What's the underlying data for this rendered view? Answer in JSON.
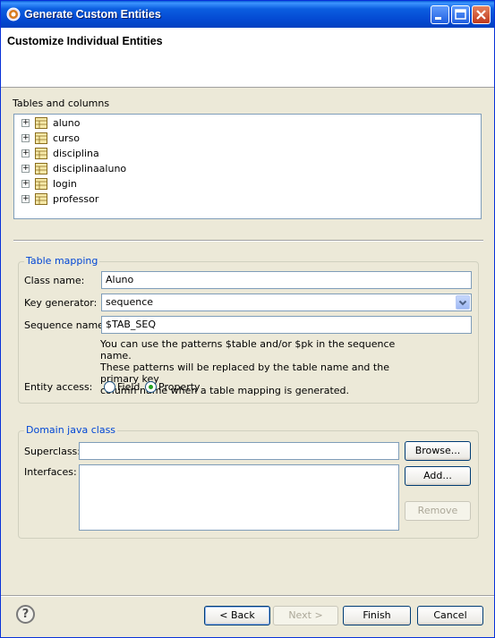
{
  "window": {
    "title": "Generate Custom Entities"
  },
  "header": {
    "title": "Customize Individual Entities"
  },
  "tables": {
    "label": "Tables and columns",
    "items": [
      "aluno",
      "curso",
      "disciplina",
      "disciplinaaluno",
      "login",
      "professor"
    ]
  },
  "table_mapping": {
    "title": "Table mapping",
    "class_name_label": "Class name:",
    "class_name_value": "Aluno",
    "key_generator_label": "Key generator:",
    "key_generator_value": "sequence",
    "sequence_name_label": "Sequence name:",
    "sequence_name_value": "$TAB_SEQ",
    "hint_lines": [
      "You can use the patterns $table and/or $pk in the sequence name.",
      "These patterns will be replaced by the table name and the primary key",
      "column name when a table mapping is generated."
    ],
    "entity_access_label": "Entity access:",
    "field_option": "Field",
    "property_option": "Property",
    "selected_access": "Property"
  },
  "domain_class": {
    "title": "Domain java class",
    "superclass_label": "Superclass:",
    "superclass_value": "",
    "interfaces_label": "Interfaces:",
    "browse_button": "Browse...",
    "add_button": "Add...",
    "remove_button": "Remove"
  },
  "footer": {
    "back_button": "< Back",
    "next_button": "Next >",
    "finish_button": "Finish",
    "cancel_button": "Cancel"
  },
  "colors": {
    "group_title": "#0046d5",
    "titlebar": "#0449d2",
    "dialog_bg": "#ece9d8"
  }
}
